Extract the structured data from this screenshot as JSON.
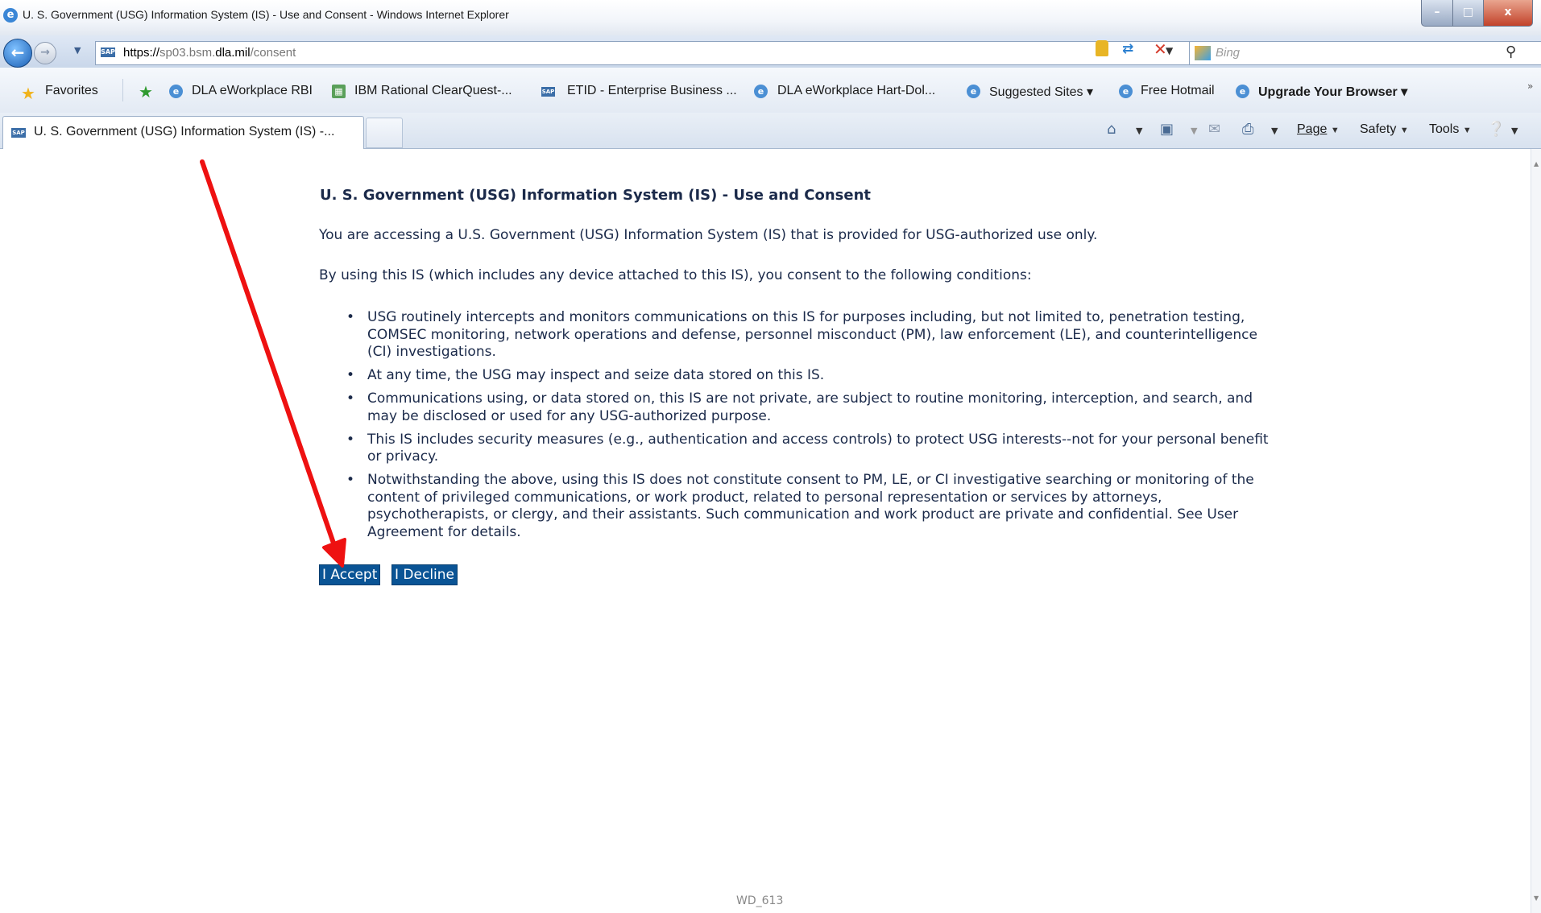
{
  "window": {
    "title": "U. S. Government (USG) Information System (IS) - Use and Consent - Windows Internet Explorer",
    "minimize_glyph": "–",
    "maximize_glyph": "□",
    "close_glyph": "x"
  },
  "address_bar": {
    "url_prefix": "https://",
    "url_sub": "sp03.bsm.",
    "url_host": "dla.mil",
    "url_path": "/consent",
    "site_icon_label": "SAP"
  },
  "search": {
    "placeholder": "Bing",
    "icon": "search-icon"
  },
  "favorites_bar": {
    "label": "Favorites",
    "links": [
      "DLA eWorkplace RBI",
      "IBM Rational ClearQuest-...",
      "ETID - Enterprise Business ...",
      "DLA eWorkplace Hart-Dol...",
      "Suggested Sites ▾",
      "Free Hotmail",
      "Upgrade Your Browser ▾"
    ],
    "more": "»"
  },
  "tabs": {
    "active_title": "U. S. Government (USG) Information System (IS) -...",
    "tab_icon_label": "SAP"
  },
  "command_bar": {
    "page": "Page",
    "safety": "Safety",
    "tools": "Tools"
  },
  "consent": {
    "heading": "U. S. Government (USG) Information System (IS) - Use and Consent",
    "intro_1": "You are accessing a U.S. Government (USG) Information System (IS) that is provided for USG-authorized use only.",
    "intro_2": "By using this IS (which includes any device attached to this IS), you consent to the following conditions:",
    "conditions": [
      "USG routinely intercepts and monitors communications on this IS for purposes including, but not limited to, penetration testing, COMSEC monitoring, network operations and defense, personnel misconduct (PM), law enforcement (LE), and counterintelligence (CI) investigations.",
      "At any time, the USG may inspect and seize data stored on this IS.",
      "Communications using, or data stored on, this IS are not private, are subject to routine monitoring, interception, and search, and may be disclosed or used for any USG-authorized purpose.",
      "This IS includes security measures (e.g., authentication and access controls) to protect USG interests--not for your personal benefit or privacy.",
      "Notwithstanding the above, using this IS does not constitute consent to PM, LE, or CI investigative searching or monitoring of the content of privileged communications, or work product, related to personal representation or services by attorneys, psychotherapists, or clergy, and their assistants. Such communication and work product are private and confidential. See User Agreement for details."
    ],
    "accept_label": "I Accept",
    "decline_label": "I Decline"
  },
  "footer": {
    "code": "WD_613"
  },
  "colors": {
    "button_bg": "#0a5495",
    "text": "#1b2a4a",
    "annotation_arrow": "#ee1111"
  }
}
